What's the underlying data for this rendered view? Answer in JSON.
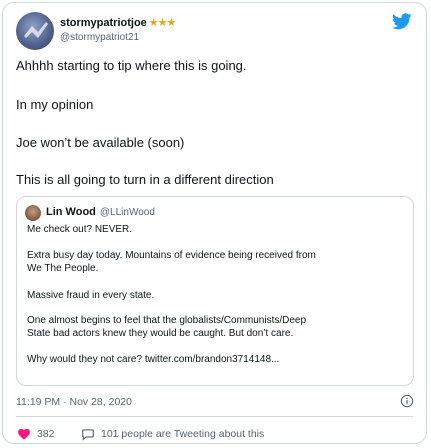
{
  "author": {
    "display_name": "stormypatriotjoe",
    "badge": "★★★",
    "handle": "@stormypatriot21"
  },
  "tweet_lines": [
    "Ahhhh starting to tip where this is going.",
    "In my opinion",
    "Joe won’t be available (soon)",
    "This is all going to turn in a different direction"
  ],
  "quoted": {
    "display_name": "Lin Wood",
    "handle": "@LLinWood",
    "lines": [
      "Me check out? NEVER.",
      "Extra busy day today. Mountains of evidence being received from",
      "We The People.",
      "Massive fraud in every state.",
      "One almost begins to feel that the globalists/Communists/Deep",
      "State bad actors knew they would be caught. But don’t care.",
      "Why would they not care? twitter.com/brandon3714148..."
    ]
  },
  "timestamp": "11:19 PM · Nov 28, 2020",
  "actions": {
    "likes": "382",
    "tweeting_about": "101 people are Tweeting about this"
  },
  "colors": {
    "twitter_blue": "#1d9bf0",
    "like_red": "#f91880",
    "muted": "#536471",
    "border": "#cfd9de",
    "stars": "#e8a317"
  }
}
